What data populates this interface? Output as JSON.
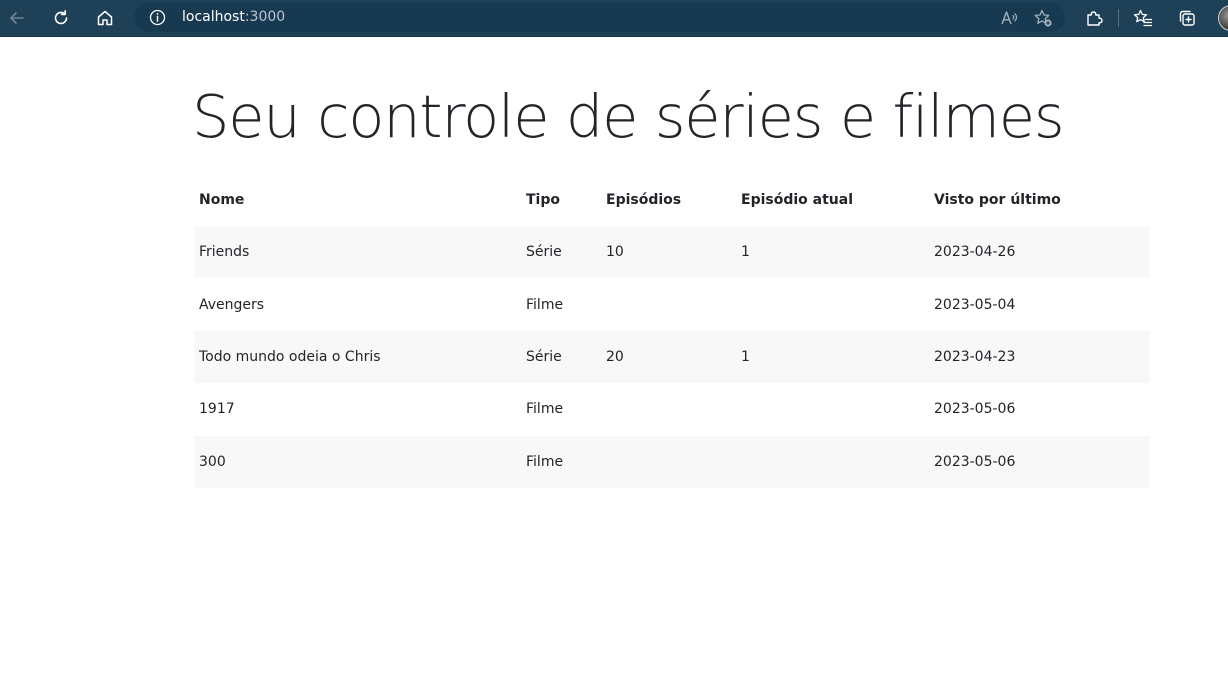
{
  "browser": {
    "url_host": "localhost",
    "url_port": ":3000",
    "icons": [
      "back-arrow-icon",
      "refresh-icon",
      "home-icon",
      "info-icon",
      "read-aloud-icon",
      "favorite-add-icon",
      "extensions-icon",
      "favorites-icon",
      "collections-icon"
    ]
  },
  "page": {
    "title": "Seu controle de séries e filmes"
  },
  "table": {
    "headers": [
      "Nome",
      "Tipo",
      "Episódios",
      "Episódio atual",
      "Visto por último"
    ],
    "rows": [
      [
        "Friends",
        "Série",
        "10",
        "1",
        "2023-04-26"
      ],
      [
        "Avengers",
        "Filme",
        "",
        "",
        "2023-05-04"
      ],
      [
        "Todo mundo odeia o Chris",
        "Série",
        "20",
        "1",
        "2023-04-23"
      ],
      [
        "1917",
        "Filme",
        "",
        "",
        "2023-05-06"
      ],
      [
        "300",
        "Filme",
        "",
        "",
        "2023-05-06"
      ]
    ]
  }
}
